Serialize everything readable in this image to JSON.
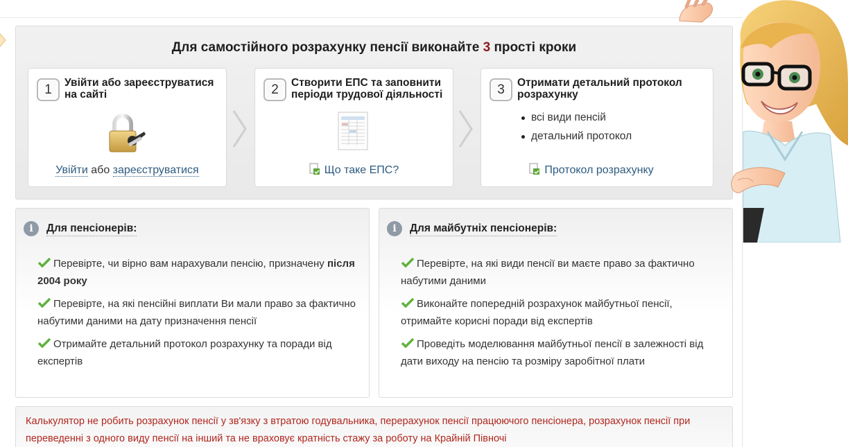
{
  "steps_panel": {
    "title_before": "Для самостійного розрахунку пенсії виконайте ",
    "title_number": "3",
    "title_after": " прості кроки"
  },
  "steps": [
    {
      "number": "1",
      "title": "Увійти або зареєструватися на сайті",
      "icon": "padlock-key-icon",
      "login_link": "Увійти",
      "or_text": " або ",
      "register_link": "зареєструватися"
    },
    {
      "number": "2",
      "title": "Створити ЕПС та заповнити періоди трудової діяльності",
      "icon": "spreadsheet-icon",
      "link": "Що таке ЕПС?"
    },
    {
      "number": "3",
      "title": "Отримати детальний протокол розрахунку",
      "bullets": [
        "всі види пенсій",
        "детальний протокол"
      ],
      "link": "Протокол розрахунку"
    }
  ],
  "pensioners": {
    "title": "Для пенсіонерів:",
    "items": [
      {
        "text": "Перевірте, чи вірно вам нарахували пенсію, призначену ",
        "bold": "після 2004 року"
      },
      {
        "text": "Перевірте, на які пенсійні виплати Ви мали право за фактично набутими даними на дату призначення пенсії",
        "bold": ""
      },
      {
        "text": "Отримайте детальний протокол розрахунку та поради від експертів",
        "bold": ""
      }
    ]
  },
  "future_pensioners": {
    "title": "Для майбутніх пенсіонерів:",
    "items": [
      {
        "text": "Перевірте, на які види пенсії ви маєте право за фактично набутими даними"
      },
      {
        "text": "Виконайте попередній розрахунок майбутньої пенсії, отримайте корисні поради від експертів"
      },
      {
        "text": "Проведіть моделювання майбутньої пенсії в залежності від дати виходу на пенсію та розміру заробітної плати"
      }
    ]
  },
  "warning": {
    "text": "Калькулятор не робить розрахунок пенсії у зв'язку з втратою годувальника, перерахунок пенсії працюючого пенсіонера, розрахунок пенсії при переведенні з одного виду пенсії на інший та не враховує кратність стажу за роботу на Крайній Півночі"
  },
  "colors": {
    "accent_number": "#8b1a1a",
    "link": "#2d5b80",
    "warning_text": "#b0271f",
    "check_green": "#5fb23c",
    "info_icon": "#8f9aa6"
  }
}
